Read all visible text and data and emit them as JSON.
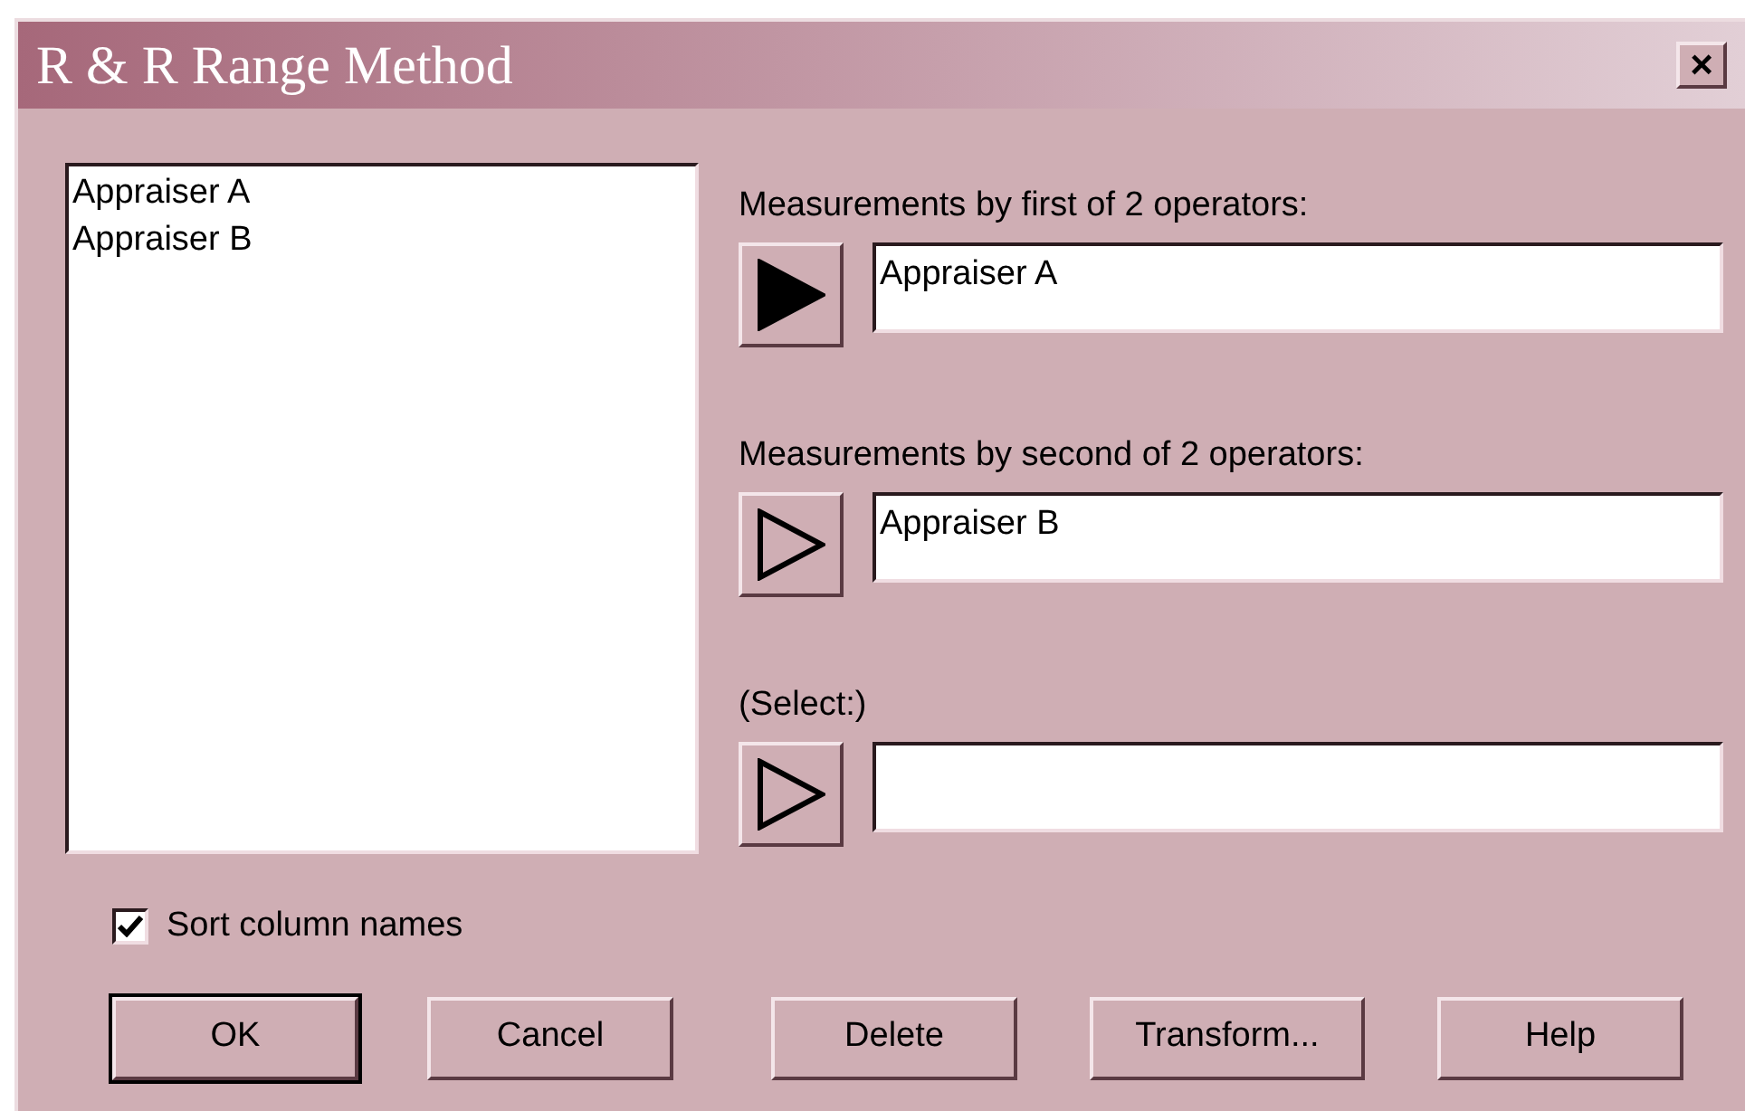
{
  "window": {
    "title": "R & R Range Method",
    "close": "×"
  },
  "columns_list": {
    "items": [
      "Appraiser A",
      "Appraiser B"
    ]
  },
  "inputs": [
    {
      "label": "Measurements by first of 2 operators:",
      "value": "Appraiser A",
      "active": true
    },
    {
      "label": "Measurements by second of 2 operators:",
      "value": "Appraiser B",
      "active": false
    },
    {
      "label": "(Select:)",
      "active": false
    }
  ],
  "sort_checkbox": {
    "label": "Sort column names",
    "checked": true
  },
  "buttons": [
    {
      "label": "OK",
      "default": true
    },
    {
      "label": "Cancel",
      "default": false
    },
    {
      "label": "Delete",
      "default": false
    },
    {
      "label": "Transform...",
      "default": false
    },
    {
      "label": "Help",
      "default": false
    }
  ]
}
